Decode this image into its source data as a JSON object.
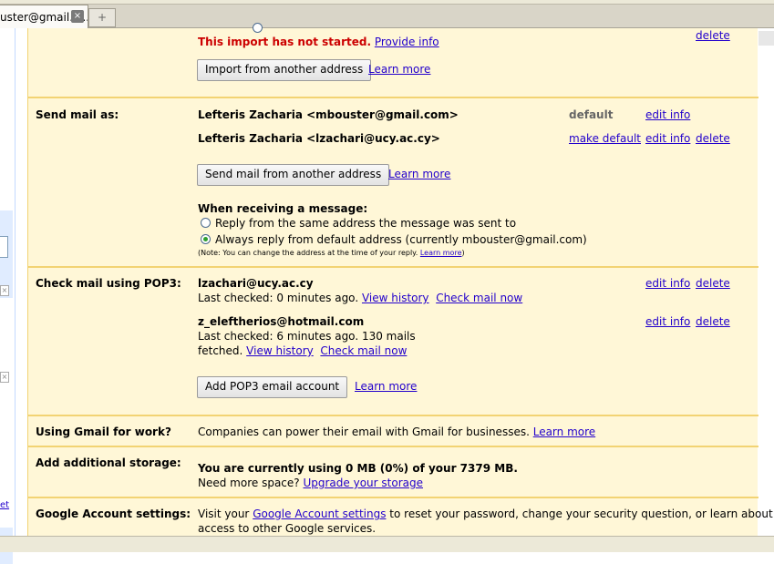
{
  "browser": {
    "tab_title": "uster@gmail.c...",
    "tab_close": "×",
    "new_tab": "+"
  },
  "sidebar": {
    "small_link": "et"
  },
  "import": {
    "status": "This import has not started.",
    "provide_info": "Provide info",
    "delete": "delete",
    "button": "Import from another address",
    "learn_more": "Learn more"
  },
  "send_mail": {
    "label": "Send mail as:",
    "addresses": [
      {
        "name": "Lefteris Zacharia <mbouster@gmail.com>",
        "status": "default",
        "edit": "edit info"
      },
      {
        "name": "Lefteris Zacharia <lzachari@ucy.ac.cy>",
        "make_default": "make default",
        "edit": "edit info",
        "delete": "delete"
      }
    ],
    "button": "Send mail from another address",
    "learn_more": "Learn more",
    "receiving_heading": "When receiving a message:",
    "option_same": "Reply from the same address the message was sent to",
    "option_default": "Always reply from default address (currently mbouster@gmail.com)",
    "note": "(Note: You can change the address at the time of your reply.",
    "note_link": "Learn more",
    "note_end": ")"
  },
  "pop3": {
    "label": "Check mail using POP3:",
    "accounts": [
      {
        "email": "lzachari@ucy.ac.cy",
        "status": "Last checked: 0 minutes ago.",
        "view_history": "View history",
        "check_now": "Check mail now",
        "edit": "edit info",
        "delete": "delete"
      },
      {
        "email": "z_eleftherios@hotmail.com",
        "status": "Last checked: 6 minutes ago. 130 mails",
        "status2": "fetched.",
        "view_history": "View history",
        "check_now": "Check mail now",
        "edit": "edit info",
        "delete": "delete"
      }
    ],
    "button": "Add POP3 email account",
    "learn_more": "Learn more"
  },
  "work": {
    "label": "Using Gmail for work?",
    "text": "Companies can power their email with Gmail for businesses.",
    "learn_more": "Learn more"
  },
  "storage": {
    "label": "Add additional storage:",
    "usage": "You are currently using 0 MB (0%) of your 7379 MB.",
    "need_more": "Need more space?",
    "upgrade": "Upgrade your storage"
  },
  "account": {
    "label": "Google Account settings:",
    "visit": "Visit your",
    "link": "Google Account settings",
    "rest": "to reset your password, change your security question, or learn about",
    "line2": "access to other Google services."
  }
}
